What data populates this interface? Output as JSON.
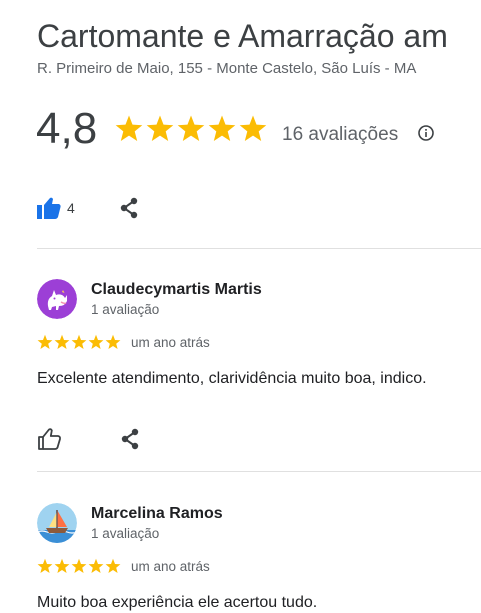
{
  "business": {
    "title": "Cartomante e Amarração am",
    "address": "R. Primeiro de Maio, 155 - Monte Castelo, São Luís - MA",
    "rating_value": "4,8",
    "rating_stars": 4.8,
    "review_count_label": "16 avaliações"
  },
  "actions": {
    "like_count": "4"
  },
  "colors": {
    "star": "#fbbc04",
    "accent_blue": "#1a73e8",
    "icon_gray": "#3c4043"
  },
  "reviews": [
    {
      "name": "Claudecymartis Martis",
      "meta": "1 avaliação",
      "stars": 5,
      "date": "um ano atrás",
      "text": "Excelente atendimento, clarividência muito boa, indico.",
      "avatar_icon": "unicorn-avatar-icon"
    },
    {
      "name": "Marcelina Ramos",
      "meta": "1 avaliação",
      "stars": 5,
      "date": "um ano atrás",
      "text": "Muito boa experiência ele acertou tudo.",
      "avatar_icon": "sailboat-avatar-icon"
    }
  ]
}
